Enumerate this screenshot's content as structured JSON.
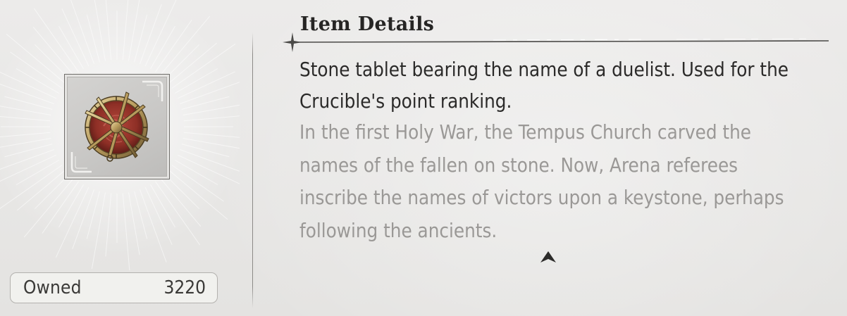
{
  "details": {
    "title": "Item Details",
    "description": "Stone tablet bearing the name of a duelist. Used for the Crucible's point ranking.",
    "lore": "In the first Holy War, the Tempus Church carved the names of the fallen on stone. Now, Arena referees inscribe the names of victors upon a keystone, perhaps following the ancients."
  },
  "inventory": {
    "owned_label": "Owned",
    "owned_count": "3220"
  },
  "item": {
    "icon": "keystone-medallion-icon"
  },
  "colors": {
    "background": "#e9e8e6",
    "text_primary": "#2b2a29",
    "text_secondary": "#9a9896",
    "medallion_red": "#8e2f26",
    "medallion_gold": "#b79a5c"
  }
}
